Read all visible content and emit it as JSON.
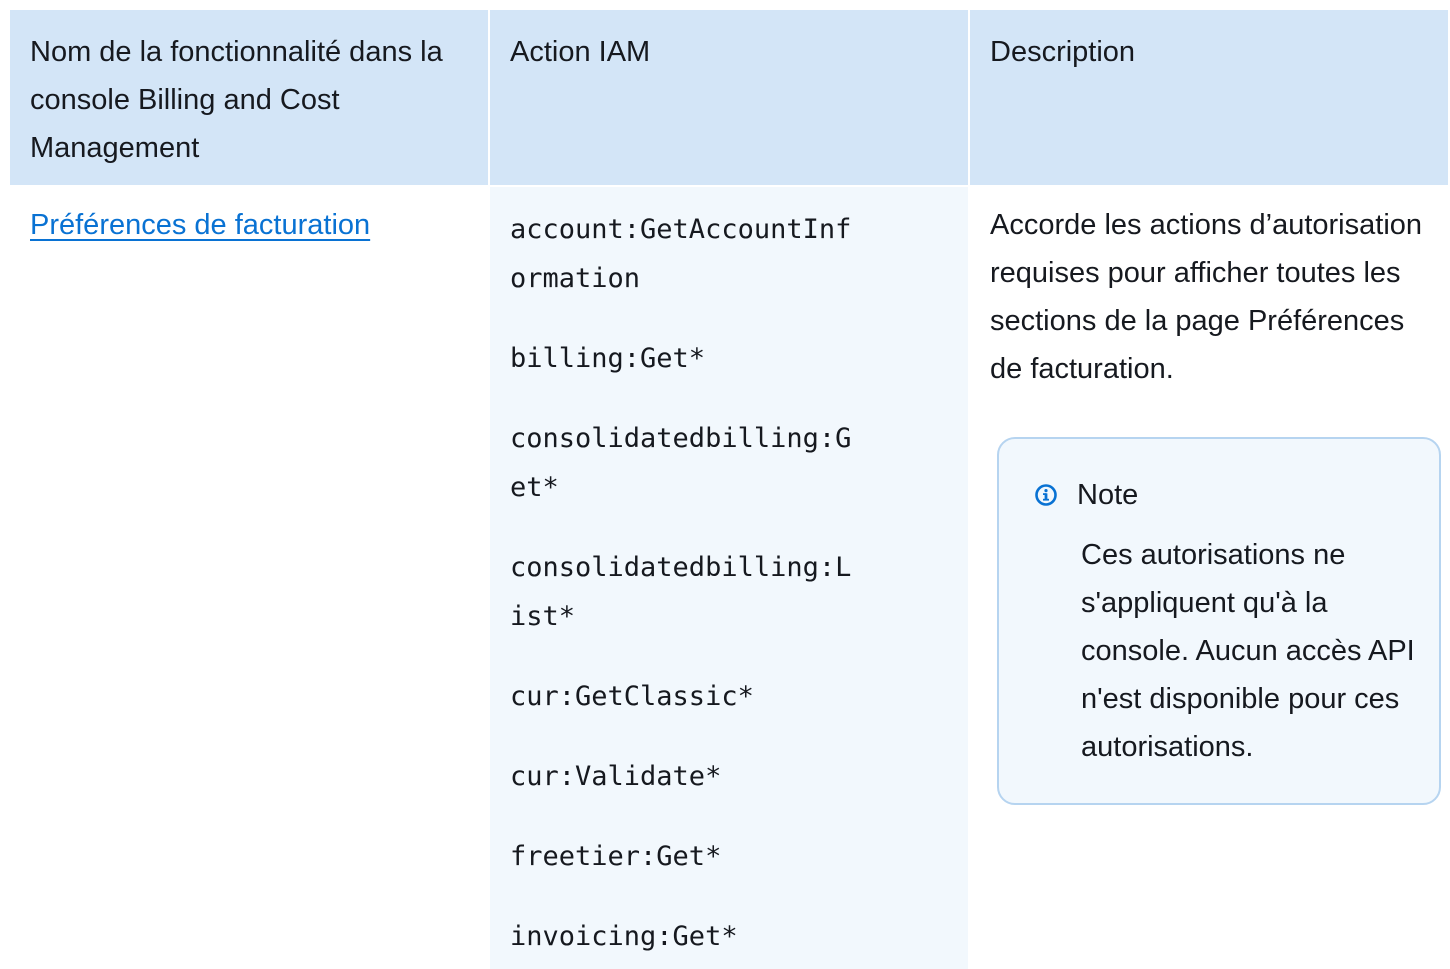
{
  "table": {
    "headers": [
      "Nom de la fonctionnalité dans la console Billing and Cost Management",
      "Action IAM",
      "Description"
    ],
    "row": {
      "feature": "Préférences de facturation",
      "actions": [
        "account:GetAccountInformation",
        "billing:Get*",
        "consolidatedbilling:Get*",
        "consolidatedbilling:List*",
        "cur:GetClassic*",
        "cur:Validate*",
        "freetier:Get*",
        "invoicing:Get*"
      ],
      "description": "Accorde les actions d’autorisation requises pour afficher toutes les sections de la page Préférences de facturation.",
      "note": {
        "icon": "info-icon",
        "title": "Note",
        "text": "Ces autorisations ne s'appliquent qu'à la console. Aucun accès API n'est disponible pour ces autorisations."
      }
    }
  },
  "colors": {
    "header_bg": "#d3e5f7",
    "action_column_bg": "#f2f8fd",
    "link": "#0972d3",
    "note_border": "#b6d4f0",
    "info_icon": "#0972d3"
  }
}
